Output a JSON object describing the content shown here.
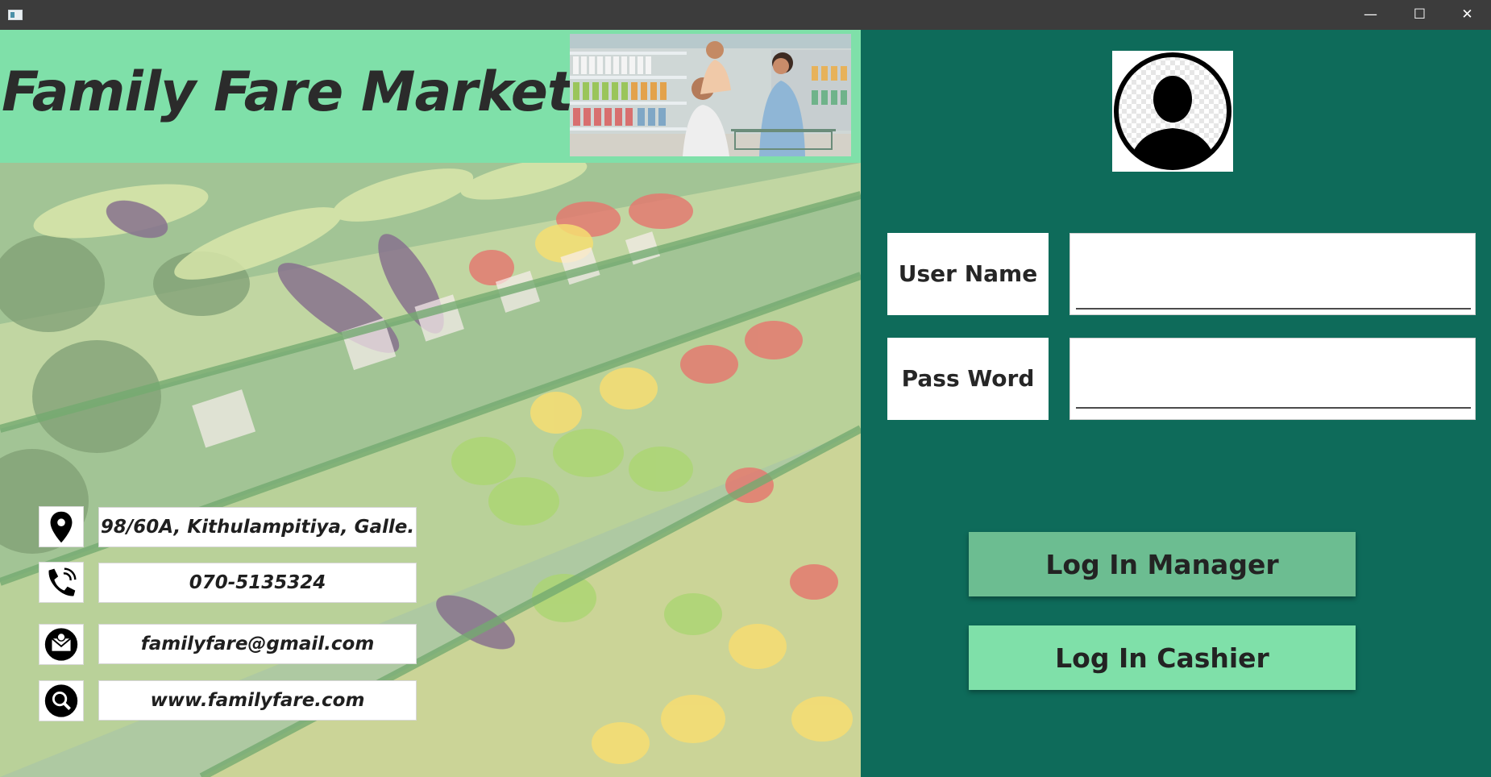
{
  "window": {
    "minimize_icon": "minimize-icon",
    "maximize_icon": "maximize-icon",
    "close_icon": "close-icon",
    "minimize_glyph": "—",
    "maximize_glyph": "☐",
    "close_glyph": "✕"
  },
  "header": {
    "title": "Family Fare Market",
    "background": "#7fe0a9"
  },
  "contacts": [
    {
      "icon": "location-pin-icon",
      "text": "98/60A, Kithulampitiya, Galle."
    },
    {
      "icon": "phone-icon",
      "text": "070-5135324"
    },
    {
      "icon": "email-icon",
      "text": "familyfare@gmail.com"
    },
    {
      "icon": "web-search-icon",
      "text": "www.familyfare.com"
    }
  ],
  "login": {
    "avatar_icon": "user-avatar-icon",
    "username_label": "User Name",
    "username_value": "",
    "password_label": "Pass Word",
    "password_value": "",
    "manager_button": "Log In Manager",
    "cashier_button": "Log In Cashier"
  },
  "colors": {
    "panel_background": "#0e6b5a",
    "accent_light": "#7fe0a9",
    "accent_dark": "#6cbd91",
    "titlebar": "#3c3c3c"
  }
}
